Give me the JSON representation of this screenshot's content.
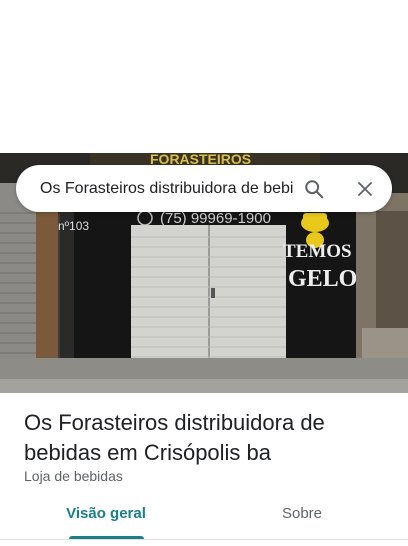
{
  "photo": {
    "sign_top": "FORASTEIROS",
    "phone": "(75) 99969-1900",
    "street_number": "nº103",
    "promo_line1": "TEMOS",
    "promo_line2": "GELO"
  },
  "search": {
    "query": "Os Forasteiros distribuidora de bebi",
    "search_icon": "search-icon",
    "close_icon": "close-icon"
  },
  "place": {
    "title": "Os Forasteiros distribuidora de bebidas em Crisópolis ba",
    "category": "Loja de bebidas"
  },
  "tabs": [
    {
      "label": "Visão geral",
      "active": true
    },
    {
      "label": "Sobre",
      "active": false
    }
  ],
  "colors": {
    "accent": "#1a7f86",
    "text_primary": "#202124",
    "text_secondary": "#5f6368",
    "sign_yellow": "#e8c81c"
  }
}
